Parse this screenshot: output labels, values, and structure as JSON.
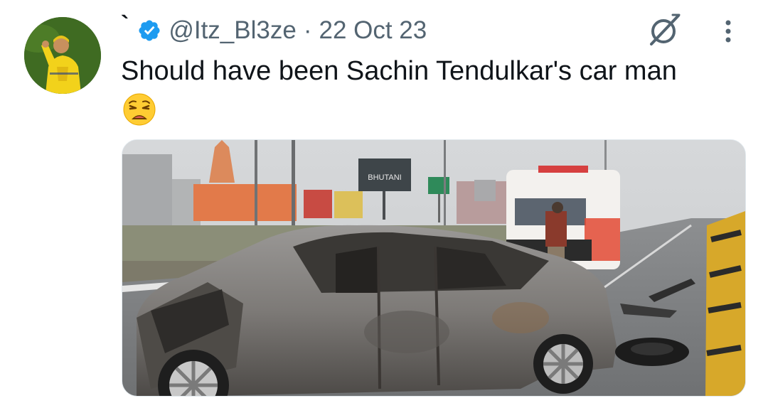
{
  "tweet": {
    "display_name": "`",
    "handle": "@Itz_Bl3ze",
    "separator": "·",
    "date": "22 Oct 23",
    "text": "Should have been Sachin Tendulkar's car man",
    "emoji": "weary-face"
  },
  "media": {
    "billboard_text": "BHUTANI",
    "description_icons": [
      "grok-icon",
      "more-icon",
      "verified-badge-icon"
    ]
  },
  "colors": {
    "verified_blue": "#1d9bf0",
    "secondary_text": "#536471",
    "primary_text": "#0f1419"
  }
}
